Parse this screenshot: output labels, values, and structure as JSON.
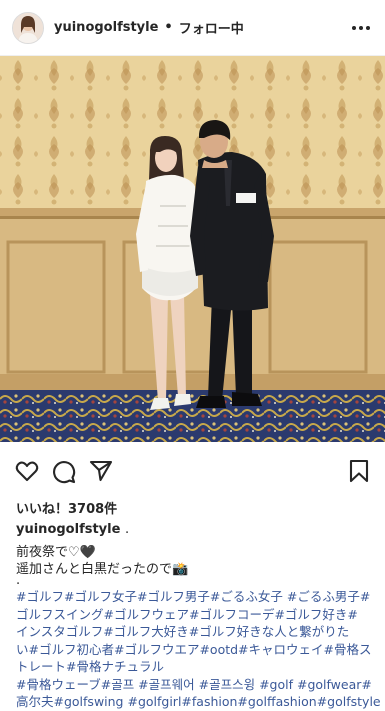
{
  "header": {
    "username": "yuinogolfstyle",
    "separator": "•",
    "follow_state": "フォロー中"
  },
  "icons": {
    "like": "heart-icon",
    "comment": "comment-icon",
    "share": "paper-plane-icon",
    "save": "bookmark-icon",
    "more": "ellipsis-icon"
  },
  "post": {
    "likes_label": "いいね！3708件",
    "caption_username": "yuinogolfstyle",
    "caption_suffix": ".",
    "caption_line1": "前夜祭で♡🖤",
    "caption_line2": "遥加さんと白黒だったので📸",
    "caption_line3": ".",
    "hashtag_lines": [
      "#ゴルフ#ゴルフ女子#ゴルフ男子#ごるふ女子 #ごるふ男子#",
      "ゴルフスイング#ゴルフウェア#ゴルフコーデ#ゴルフ好き#",
      "インスタゴルフ#ゴルフ大好き#ゴルフ好きな人と繋がりた",
      "い#ゴルフ初心者#ゴルフウエア#ootd#キャロウェイ#骨格ス",
      "トレート#骨格ナチュラル",
      "#骨格ウェーブ#골프 #골프웨어 #골프스윙 #golf #golfwear#",
      "高尔夫#golfswing #golfgirl#fashion#golffashion#golfstyle"
    ]
  },
  "colors": {
    "text": "#262626",
    "hashtag": "#3b5998",
    "wallpaper": "#e6cd93",
    "wainscot": "#d4b47b",
    "carpet": "#2b3a6e"
  }
}
